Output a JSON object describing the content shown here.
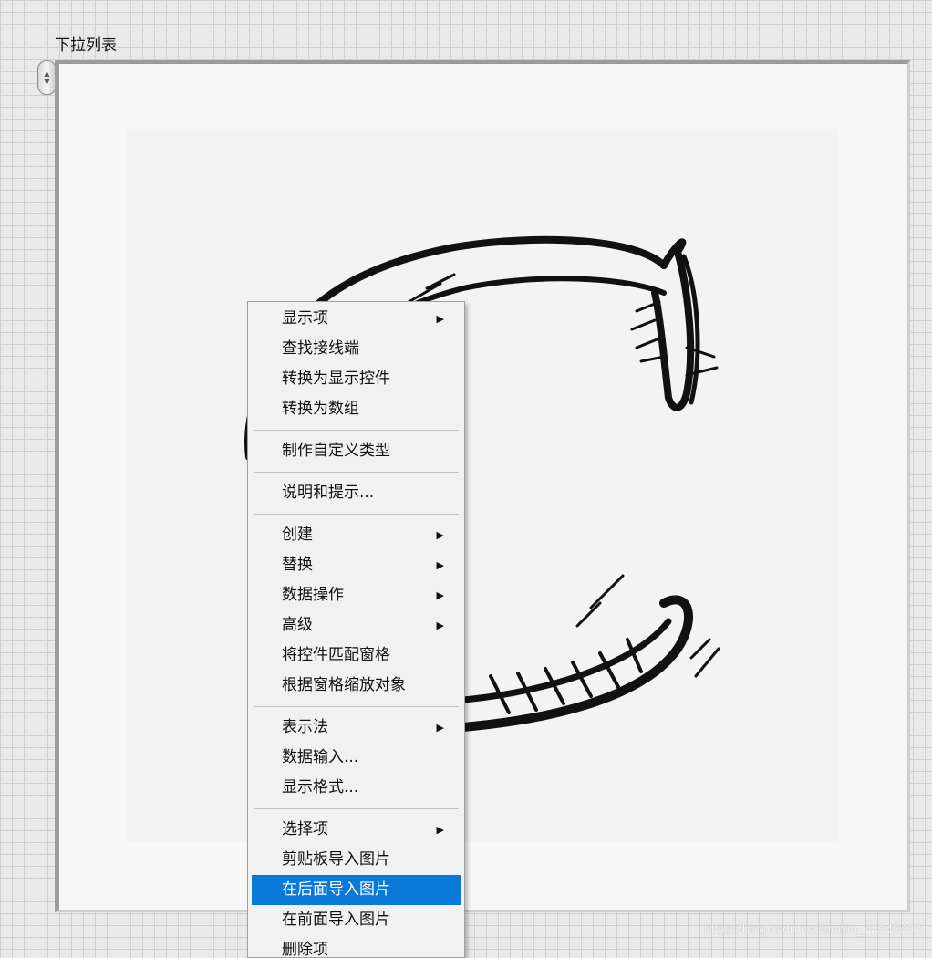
{
  "control": {
    "label": "下拉列表",
    "stepper_icon": "up-down-arrows"
  },
  "menu": {
    "groups": [
      [
        {
          "label": "显示项",
          "submenu": true
        },
        {
          "label": "查找接线端",
          "submenu": false
        },
        {
          "label": "转换为显示控件",
          "submenu": false
        },
        {
          "label": "转换为数组",
          "submenu": false
        }
      ],
      [
        {
          "label": "制作自定义类型",
          "submenu": false
        }
      ],
      [
        {
          "label": "说明和提示...",
          "submenu": false
        }
      ],
      [
        {
          "label": "创建",
          "submenu": true
        },
        {
          "label": "替换",
          "submenu": true
        },
        {
          "label": "数据操作",
          "submenu": true
        },
        {
          "label": "高级",
          "submenu": true
        },
        {
          "label": "将控件匹配窗格",
          "submenu": false
        },
        {
          "label": "根据窗格缩放对象",
          "submenu": false
        }
      ],
      [
        {
          "label": "表示法",
          "submenu": true
        },
        {
          "label": "数据输入...",
          "submenu": false
        },
        {
          "label": "显示格式...",
          "submenu": false
        }
      ],
      [
        {
          "label": "选择项",
          "submenu": true
        },
        {
          "label": "剪贴板导入图片",
          "submenu": false
        },
        {
          "label": "在后面导入图片",
          "submenu": false,
          "highlighted": true
        },
        {
          "label": "在前面导入图片",
          "submenu": false
        },
        {
          "label": "删除项",
          "submenu": false
        }
      ]
    ],
    "submenu_arrow": "▶",
    "highlight_color": "#0a78d7"
  },
  "watermark": "https://blog.csdn.net/weixin_44543463"
}
